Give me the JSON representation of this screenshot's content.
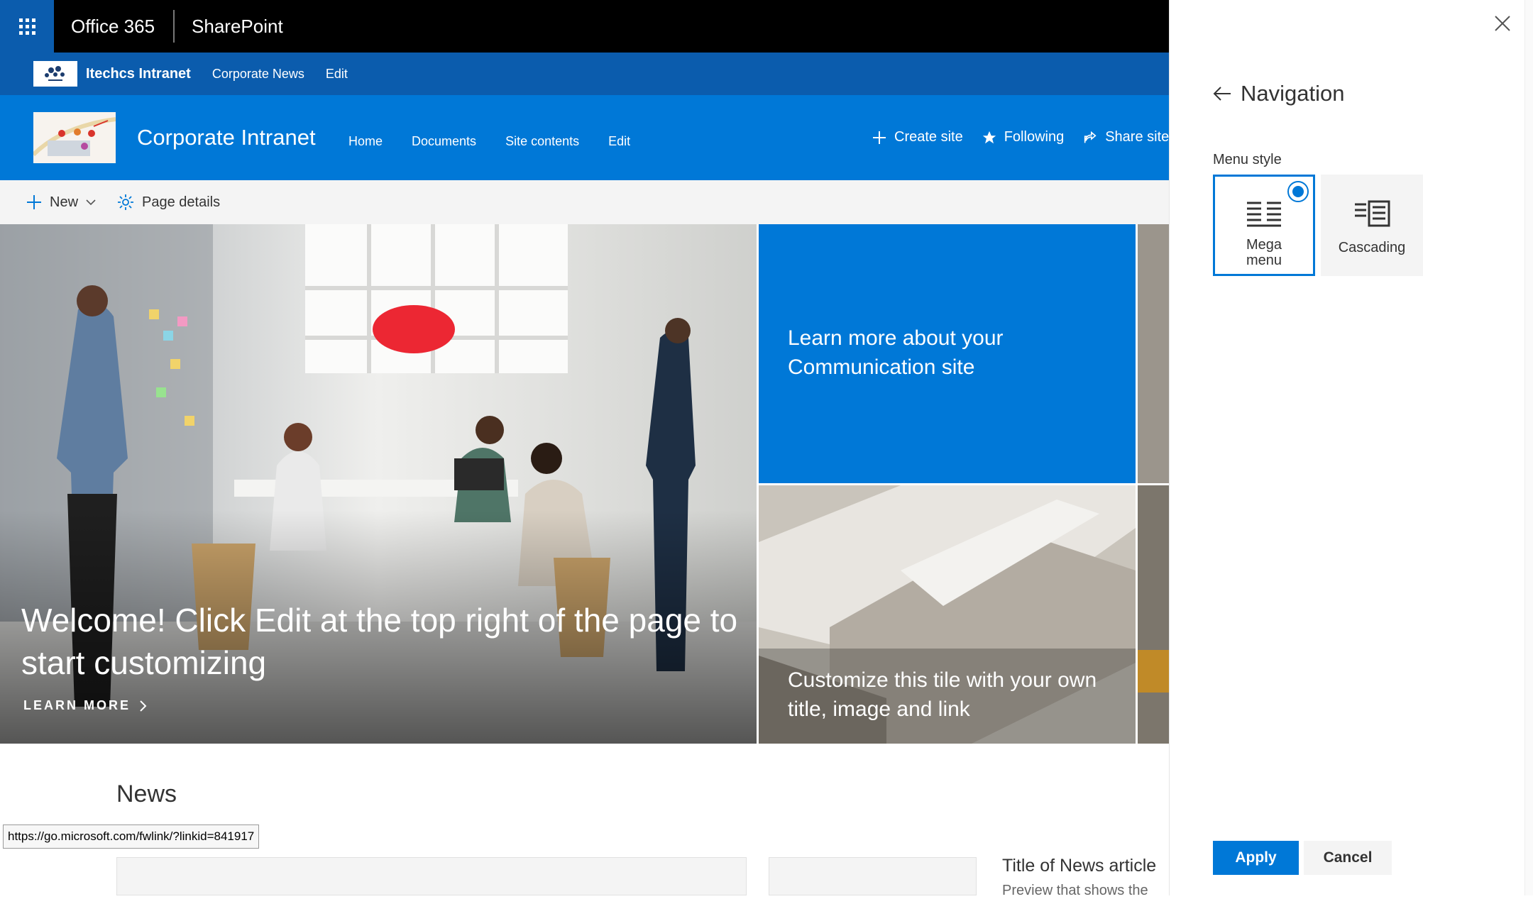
{
  "suite_bar": {
    "brand": "Office 365",
    "app": "SharePoint"
  },
  "hub_nav": {
    "title": "Itechcs Intranet",
    "links": [
      "Corporate News",
      "Edit"
    ]
  },
  "site_header": {
    "title": "Corporate Intranet",
    "nav": [
      "Home",
      "Documents",
      "Site contents",
      "Edit"
    ],
    "actions": {
      "create": "Create site",
      "following": "Following",
      "share": "Share site"
    }
  },
  "command_bar": {
    "new_label": "New",
    "page_details_label": "Page details"
  },
  "hero": {
    "main_title": "Welcome! Click Edit at the top right of the page to start customizing",
    "learn_more": "LEARN MORE",
    "tile_blue_text": "Learn more about your Communication site",
    "tile_arch_text": "Customize this tile with your own title, image and link"
  },
  "news": {
    "heading": "News",
    "article_title": "Title of News article",
    "article_preview": "Preview that shows the"
  },
  "status_url": "https://go.microsoft.com/fwlink/?linkid=841917",
  "panel": {
    "title": "Navigation",
    "menu_style_label": "Menu style",
    "options": [
      "Mega menu",
      "Cascading"
    ],
    "selected": "Mega menu",
    "apply_label": "Apply",
    "cancel_label": "Cancel"
  },
  "colors": {
    "accent": "#0078d7",
    "hub": "#0b5cad",
    "suite": "#000000"
  }
}
